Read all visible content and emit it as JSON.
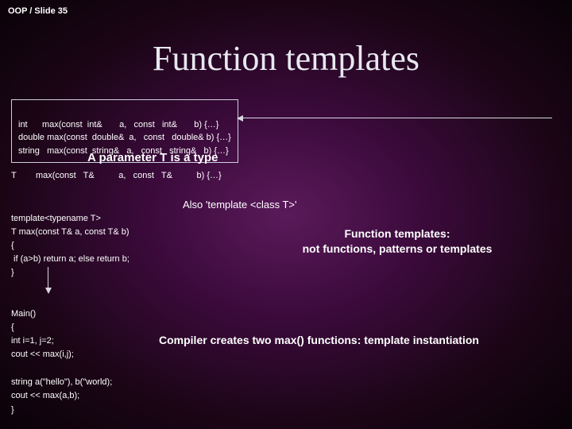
{
  "breadcrumb": "OOP / Slide 35",
  "title": "Function templates",
  "overloads": {
    "l1": "int      max(const  int&       a,   const   int&       b) {…}",
    "l2": "double max(const  double&  a,   const   double& b) {…}",
    "l3": "string   max(const  string&   a,   const   string&   b) {…}"
  },
  "subheading": "A parameter T is a type",
  "generic_sig": "T        max(const   T&          a,   const   T&          b) {…}",
  "template_def": {
    "l1": "template<typename T>",
    "l2": "T max(const T& a, const T& b)",
    "l3": "{",
    "l4": " if (a>b) return a; else return b;",
    "l5": "}"
  },
  "also_note": "Also 'template <class T>'",
  "ft_note_l1": "Function templates:",
  "ft_note_l2": "not functions, patterns or templates",
  "main_code": {
    "l1": "Main()",
    "l2": "{",
    "l3": "int i=1, j=2;",
    "l4": "cout << max(i,j);"
  },
  "compiler_note": "Compiler creates two max() functions: template instantiation",
  "string_code": {
    "l1": "string a(\"hello\"), b(\"world);",
    "l2": "cout << max(a,b);",
    "l3": "}"
  }
}
